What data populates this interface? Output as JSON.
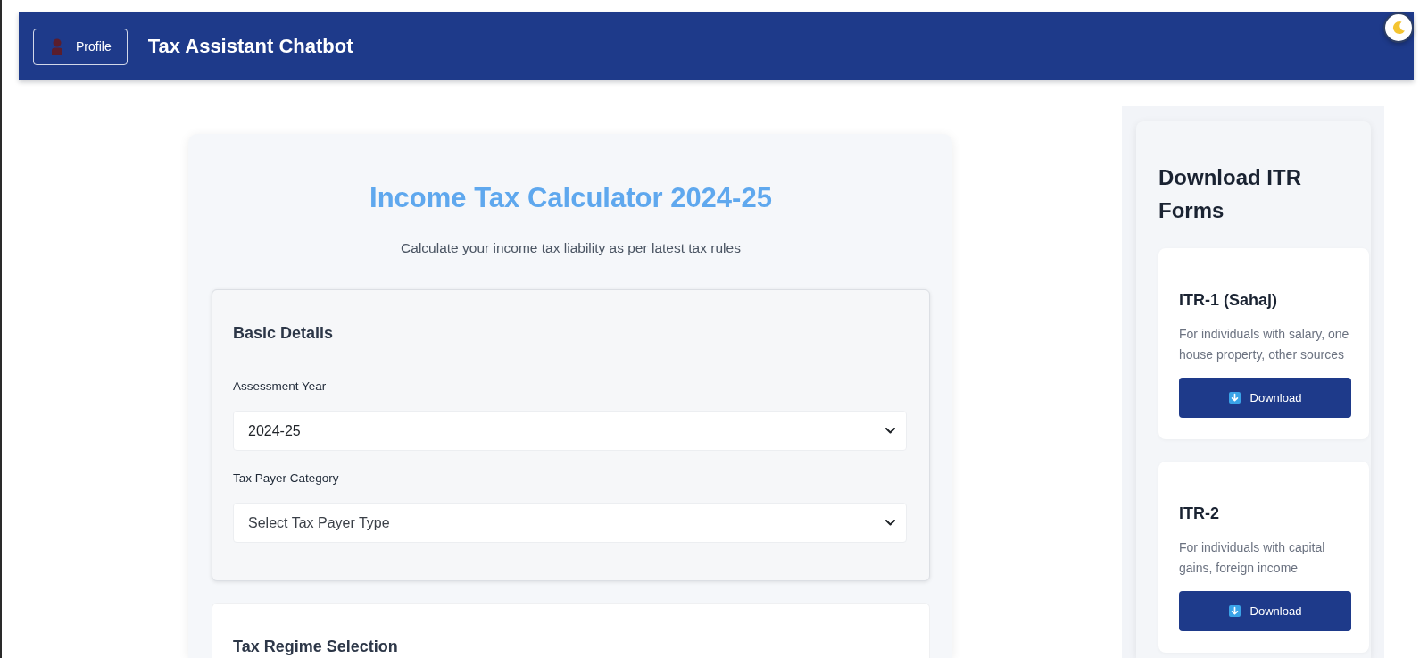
{
  "header": {
    "profile_button": "Profile",
    "title": "Tax Assistant Chatbot"
  },
  "calculator": {
    "title": "Income Tax Calculator 2024-25",
    "subtitle": "Calculate your income tax liability as per latest tax rules",
    "sections": [
      {
        "heading": "Basic Details",
        "active": true,
        "fields": [
          {
            "label": "Assessment Year",
            "value": "2024-25"
          },
          {
            "label": "Tax Payer Category",
            "placeholder": "Select Tax Payer Type"
          }
        ]
      },
      {
        "heading": "Tax Regime Selection",
        "active": false
      }
    ]
  },
  "sidebar": {
    "heading": "Download ITR Forms",
    "forms": [
      {
        "name": "ITR-1 (Sahaj)",
        "description": "For individuals with salary, one house property, other sources",
        "button": "Download"
      },
      {
        "name": "ITR-2",
        "description": "For individuals with capital gains, foreign income",
        "button": "Download"
      }
    ]
  }
}
